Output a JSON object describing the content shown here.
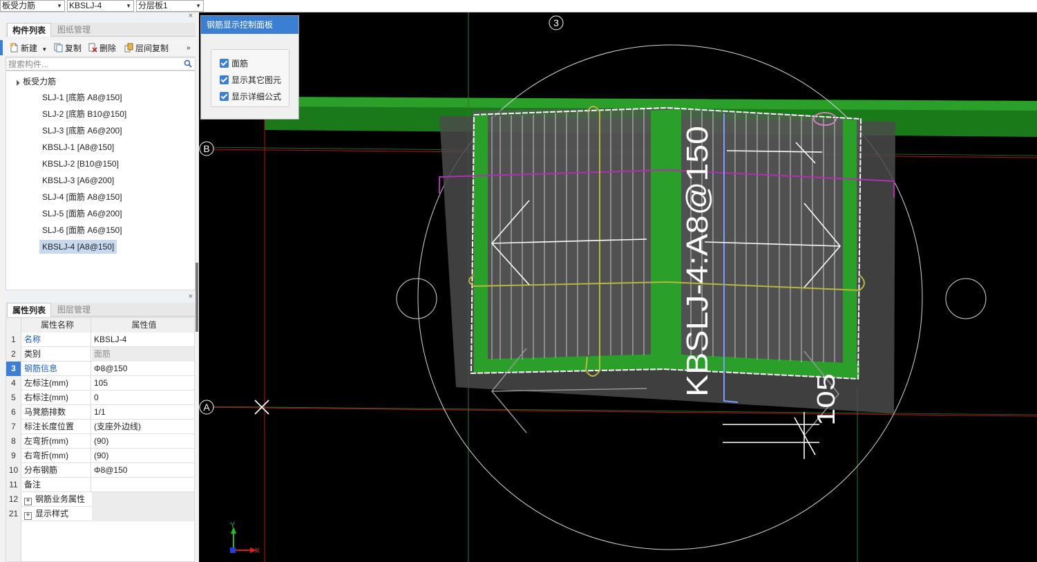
{
  "topbar": {
    "combo1": "板受力筋",
    "combo2": "KBSLJ-4",
    "combo3": "分层板1"
  },
  "component_panel": {
    "tabs": [
      "构件列表",
      "图纸管理"
    ],
    "toolbar": {
      "new": "新建",
      "copy": "复制",
      "delete": "删除",
      "floor_copy": "层间复制"
    },
    "search_placeholder": "搜索构件...",
    "tree_root": "板受力筋",
    "items": [
      "SLJ-1 [底筋 A8@150]",
      "SLJ-2 [底筋 B10@150]",
      "SLJ-3 [底筋 A6@200]",
      "KBSLJ-1 [A8@150]",
      "KBSLJ-2 [B10@150]",
      "KBSLJ-3 [A6@200]",
      "SLJ-4 [面筋 A8@150]",
      "SLJ-5 [面筋 A6@200]",
      "SLJ-6 [面筋 A6@150]",
      "KBSLJ-4 [A8@150]"
    ]
  },
  "property_panel": {
    "tabs": [
      "属性列表",
      "图层管理"
    ],
    "col_name": "属性名称",
    "col_value": "属性值",
    "rows": [
      {
        "num": "1",
        "name": "名称",
        "value": "KBSLJ-4"
      },
      {
        "num": "2",
        "name": "类别",
        "value": "面筋"
      },
      {
        "num": "3",
        "name": "钢筋信息",
        "value": "Φ8@150"
      },
      {
        "num": "4",
        "name": "左标注(mm)",
        "value": "105"
      },
      {
        "num": "5",
        "name": "右标注(mm)",
        "value": "0"
      },
      {
        "num": "6",
        "name": "马凳筋排数",
        "value": "1/1"
      },
      {
        "num": "7",
        "name": "标注长度位置",
        "value": "(支座外边线)"
      },
      {
        "num": "8",
        "name": "左弯折(mm)",
        "value": "(90)"
      },
      {
        "num": "9",
        "name": "右弯折(mm)",
        "value": "(90)"
      },
      {
        "num": "10",
        "name": "分布钢筋",
        "value": "Φ8@150"
      },
      {
        "num": "11",
        "name": "备注",
        "value": ""
      },
      {
        "num": "12",
        "name": "钢筋业务属性",
        "value": ""
      },
      {
        "num": "21",
        "name": "显示样式",
        "value": ""
      }
    ]
  },
  "control_panel": {
    "title": "钢筋显示控制面板",
    "options": [
      "面筋",
      "显示其它图元",
      "显示详细公式"
    ]
  },
  "canvas": {
    "axis_3": "3",
    "axis_b": "B",
    "axis_a": "A",
    "rebar_label": "KBSLJ-4:A8@150",
    "dim_label": "105",
    "x_axis": "X",
    "y_axis": "Y"
  },
  "colors": {
    "accent": "#3b7fd4",
    "canvas_bg": "#000000",
    "beam_green": "#1f8a1f",
    "grid_red": "#c0101a",
    "magenta": "#b030b0",
    "yellow": "#b8b840"
  }
}
